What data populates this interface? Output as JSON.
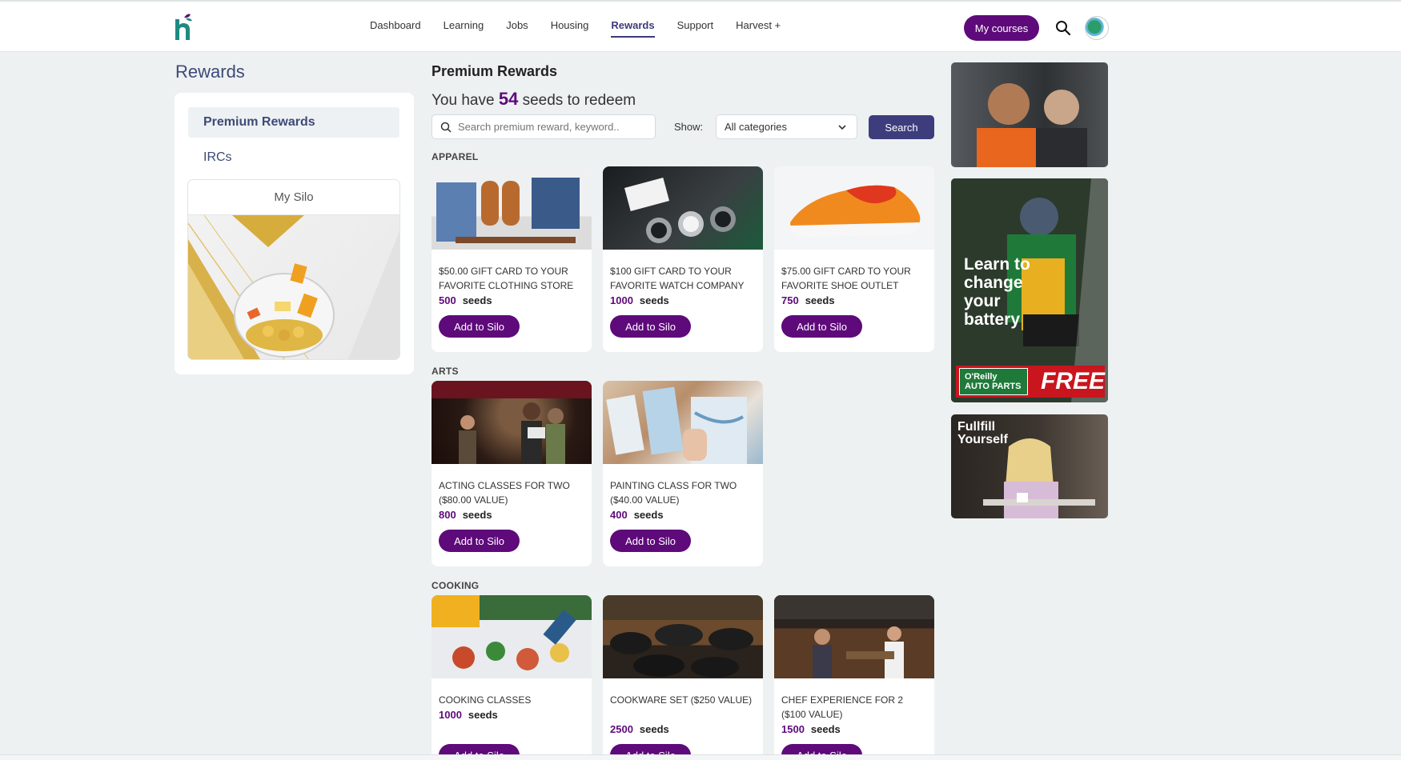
{
  "header": {
    "nav": [
      {
        "label": "Dashboard",
        "active": false
      },
      {
        "label": "Learning",
        "active": false
      },
      {
        "label": "Jobs",
        "active": false
      },
      {
        "label": "Housing",
        "active": false
      },
      {
        "label": "Rewards",
        "active": true
      },
      {
        "label": "Support",
        "active": false
      },
      {
        "label": "Harvest +",
        "active": false
      }
    ],
    "my_courses": "My courses",
    "icons": [
      "logo-icon",
      "search-icon",
      "avatar-icon"
    ]
  },
  "sidebar": {
    "title": "Rewards",
    "items": [
      {
        "label": "Premium Rewards",
        "active": true
      },
      {
        "label": "IRCs",
        "active": false
      }
    ],
    "silo_title": "My Silo"
  },
  "main": {
    "heading": "Premium Rewards",
    "seeds_prefix": "You have",
    "seeds_count": "54",
    "seeds_suffix": "seeds to redeem",
    "search_placeholder": "Search premium reward, keyword..",
    "show_label": "Show:",
    "category": "All categories",
    "search_button": "Search",
    "seeds_word": "seeds",
    "add_label": "Add to Silo",
    "sections": [
      {
        "label": "APPAREL",
        "items": [
          {
            "title": "$50.00 GIFT CARD TO YOUR FAVORITE CLOTHING STORE",
            "seeds": "500"
          },
          {
            "title": "$100 GIFT CARD TO YOUR FAVORITE WATCH COMPANY",
            "seeds": "1000"
          },
          {
            "title": "$75.00 GIFT CARD TO YOUR FAVORITE SHOE OUTLET",
            "seeds": "750"
          }
        ]
      },
      {
        "label": "ARTS",
        "items": [
          {
            "title": "ACTING CLASSES FOR TWO ($80.00 VALUE)",
            "seeds": "800"
          },
          {
            "title": "PAINTING CLASS FOR TWO ($40.00 VALUE)",
            "seeds": "400"
          }
        ]
      },
      {
        "label": "COOKING",
        "items": [
          {
            "title": "COOKING CLASSES",
            "seeds": "1000"
          },
          {
            "title": "COOKWARE SET ($250 VALUE)",
            "seeds": "2500"
          },
          {
            "title": "CHEF EXPERIENCE FOR 2 ($100 VALUE)",
            "seeds": "1500"
          }
        ]
      }
    ]
  },
  "ads": {
    "battery_text": "Learn to change your battery",
    "oreilly_brand": "O'Reilly AUTO PARTS",
    "free": "FREE",
    "fulfill": "Fullfill Yourself"
  },
  "colors": {
    "brand_purple": "#5e0a7a",
    "nav_active": "#3d3a7a",
    "search_button": "#3d3d7e"
  }
}
